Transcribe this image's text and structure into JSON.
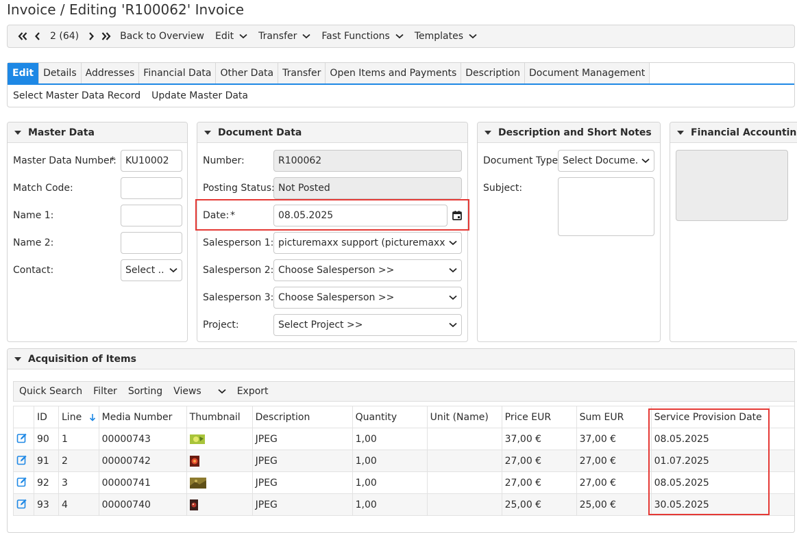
{
  "page": {
    "title": "Invoice / Editing 'R100062' Invoice"
  },
  "toolbar": {
    "record_position": "2 (64)",
    "back": "Back to Overview",
    "edit": "Edit",
    "transfer": "Transfer",
    "fast_functions": "Fast Functions",
    "templates": "Templates"
  },
  "tabs": [
    {
      "label": "Edit"
    },
    {
      "label": "Details"
    },
    {
      "label": "Addresses"
    },
    {
      "label": "Financial Data"
    },
    {
      "label": "Other Data"
    },
    {
      "label": "Transfer"
    },
    {
      "label": "Open Items and Payments"
    },
    {
      "label": "Description"
    },
    {
      "label": "Document Management"
    }
  ],
  "subactions": {
    "select_master": "Select Master Data Record",
    "update_master": "Update Master Data"
  },
  "master_data": {
    "title": "Master Data",
    "number_label": "Master Data Number:",
    "number_value": "KU10002",
    "match_code_label": "Match Code:",
    "match_code_value": "",
    "name1_label": "Name 1:",
    "name1_value": "",
    "name2_label": "Name 2:",
    "name2_value": "",
    "contact_label": "Contact:",
    "contact_value": "Select ..."
  },
  "document_data": {
    "title": "Document Data",
    "number_label": "Number:",
    "number_value": "R100062",
    "posting_label": "Posting Status:",
    "posting_value": "Not Posted",
    "date_label": "Date:",
    "date_value": "08.05.2025",
    "sp1_label": "Salesperson 1:",
    "sp1_value": "picturemaxx support (picturemaxx AG)",
    "sp2_label": "Salesperson 2:",
    "sp2_value": "Choose Salesperson >>",
    "sp3_label": "Salesperson 3:",
    "sp3_value": "Choose Salesperson >>",
    "project_label": "Project:",
    "project_value": "Select Project >>"
  },
  "description_notes": {
    "title": "Description and Short Notes",
    "doc_type_label": "Document Type:",
    "doc_type_value": "Select Docume...",
    "subject_label": "Subject:",
    "subject_value": ""
  },
  "financial_accounting": {
    "title": "Financial Accounting"
  },
  "required_marker": "*",
  "items": {
    "title": "Acquisition of Items",
    "toolbar": {
      "quick_search": "Quick Search",
      "filter": "Filter",
      "sorting": "Sorting",
      "views": "Views",
      "export": "Export"
    },
    "columns": {
      "id": "ID",
      "line": "Line",
      "media": "Media Number",
      "thumb": "Thumbnail",
      "desc": "Description",
      "qty": "Quantity",
      "unit": "Unit (Name)",
      "price": "Price EUR",
      "sum": "Sum EUR",
      "spd": "Service Provision Date"
    },
    "rows": [
      {
        "id": "90",
        "line": "1",
        "media": "00000743",
        "desc": "JPEG",
        "qty": "1,00",
        "unit": "",
        "price": "37,00 €",
        "sum": "37,00 €",
        "spd": "08.05.2025"
      },
      {
        "id": "91",
        "line": "2",
        "media": "00000742",
        "desc": "JPEG",
        "qty": "1,00",
        "unit": "",
        "price": "27,00 €",
        "sum": "27,00 €",
        "spd": "01.07.2025"
      },
      {
        "id": "92",
        "line": "3",
        "media": "00000741",
        "desc": "JPEG",
        "qty": "1,00",
        "unit": "",
        "price": "27,00 €",
        "sum": "27,00 €",
        "spd": "08.05.2025"
      },
      {
        "id": "93",
        "line": "4",
        "media": "00000740",
        "desc": "JPEG",
        "qty": "1,00",
        "unit": "",
        "price": "25,00 €",
        "sum": "25,00 €",
        "spd": "30.05.2025"
      }
    ]
  },
  "icons": {
    "first": "double-chevron-left-icon",
    "prev": "chevron-left-icon",
    "next": "chevron-right-icon",
    "last": "double-chevron-right-icon",
    "dropdown": "chevron-down-icon",
    "calendar": "calendar-icon",
    "collapse": "collapse-triangle-icon",
    "edit_row": "edit-pencil-icon",
    "sort_desc": "sort-arrow-down-icon"
  },
  "colors": {
    "accent": "#1e88e5",
    "highlight": "#e53935",
    "panel_header": "#f4f4f4",
    "readonly_field": "#ececec"
  }
}
